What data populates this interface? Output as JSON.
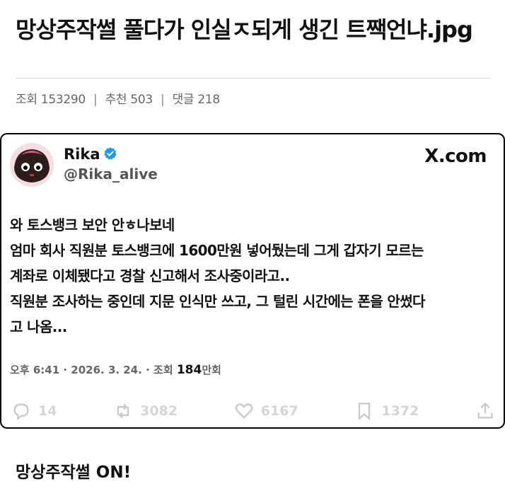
{
  "post": {
    "title": "망상주작썰 풀다가 인실ㅈ되게 생긴 트짹언냐.jpg",
    "meta": {
      "views_label": "조회",
      "views": "153290",
      "recommend_label": "추천",
      "recommend": "503",
      "comments_label": "댓글",
      "comments": "218"
    }
  },
  "tweet": {
    "author_name": "Rika",
    "handle": "@Rika_alive",
    "brand": "X.com",
    "lines": [
      "와 토스뱅크 보안 안ㅎ나보네",
      "엄마 회사 직원분 토스뱅크에 1600만원 넣어뒀는데 그게 갑자기 모르는",
      "계좌로 이체됐다고 경찰 신고해서 조사중이라고..",
      "직원분 조사하는 중인데 지문 인식만 쓰고, 그 털린 시간에는 폰을 안썼다",
      "고 나옴..."
    ],
    "time_prefix": "오후 6:41 · 2026. 3. 24. · 조회 ",
    "views": "184",
    "views_unit": "만회",
    "actions": {
      "replies": "14",
      "retweets": "3082",
      "likes": "6167",
      "bookmarks": "1372"
    },
    "colors": {
      "verified": "#1d9bf0"
    }
  },
  "footer": {
    "text": "망상주작썰 ON!"
  }
}
